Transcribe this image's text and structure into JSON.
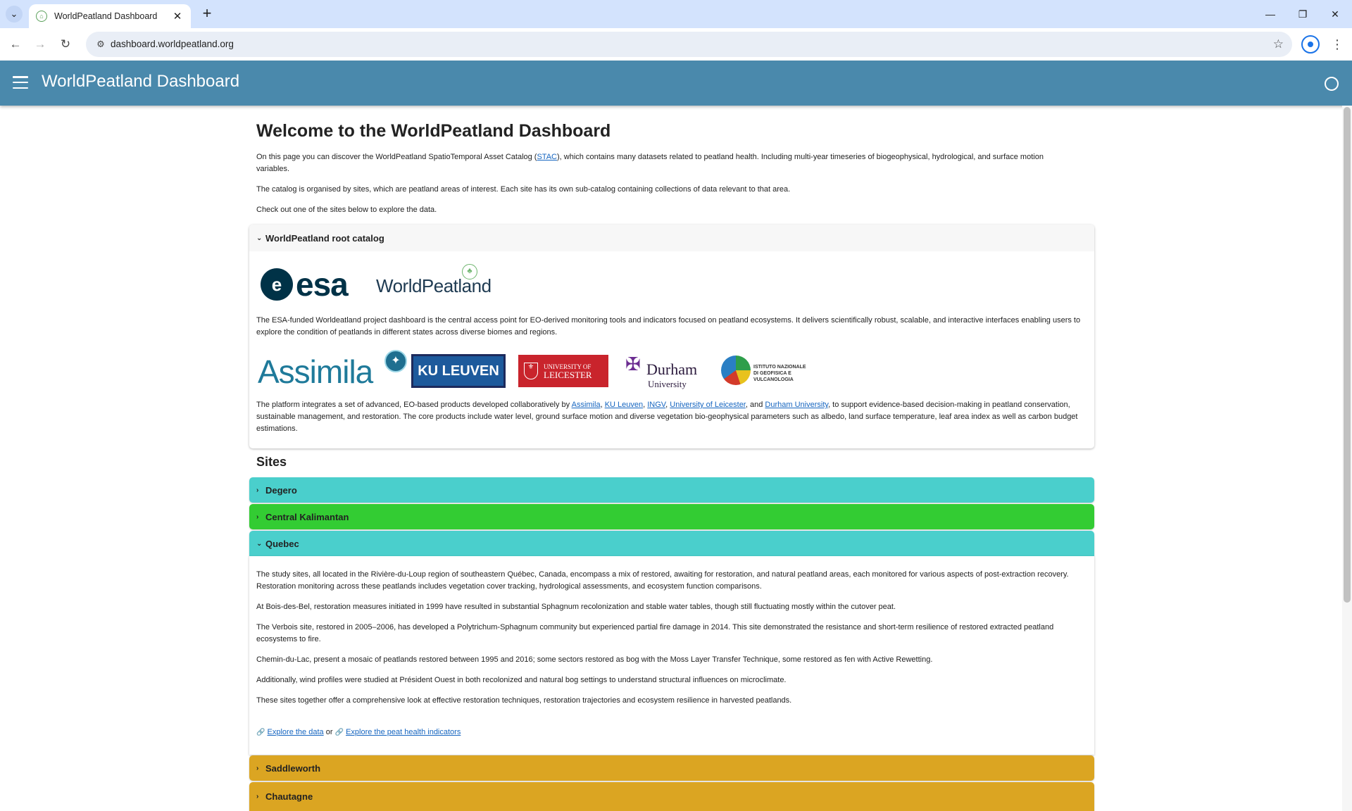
{
  "browser": {
    "tab_title": "WorldPeatland Dashboard",
    "url": "dashboard.worldpeatland.org"
  },
  "app": {
    "title": "WorldPeatland Dashboard"
  },
  "welcome": {
    "heading": "Welcome to the WorldPeatland Dashboard",
    "p1_before": "On this page you can discover the WorldPeatland SpatioTemporal Asset Catalog (",
    "p1_link": "STAC",
    "p1_after": "), which contains many datasets related to peatland health. Including multi-year timeseries of biogeophysical, hydrological, and surface motion variables.",
    "p2": "The catalog is organised by sites, which are peatland areas of interest. Each site has its own sub-catalog containing collections of data relevant to that area.",
    "p3": "Check out one of the sites below to explore the data."
  },
  "root_catalog": {
    "title": "WorldPeatland root catalog",
    "logo_esa": "esa",
    "logo_worldpeatland": "WorldPeatland",
    "description": "The ESA-funded Worldeatland project dashboard is the central access point for EO-derived monitoring tools and indicators focused on peatland ecosystems. It delivers scientifically robust, scalable, and interactive interfaces enabling users to explore the condition of peatlands in different states across diverse biomes and regions.",
    "partners": {
      "assimila": "Assimila",
      "ku_leuven": "KU LEUVEN",
      "leicester_1": "UNIVERSITY OF",
      "leicester_2": "LEICESTER",
      "durham_1": "Durham",
      "durham_2": "University",
      "ingv_1": "ISTITUTO NAZIONALE",
      "ingv_2": "DI GEOFISICA E VULCANOLOGIA"
    },
    "platform_before": "The platform integrates a set of advanced, EO-based products developed collaboratively by ",
    "link_assimila": "Assimila",
    "link_kuleuven": "KU Leuven",
    "link_ingv": "INGV",
    "link_leicester": "University of Leicester",
    "sep_comma": ", ",
    "sep_and": ", and ",
    "link_durham": "Durham University",
    "platform_after": ", to support evidence-based decision-making in peatland conservation, sustainable management, and restoration. The core products include water level, ground surface motion and diverse vegetation bio-geophysical parameters such as albedo, land surface temperature, leaf area index as well as carbon budget estimations."
  },
  "sites": {
    "heading": "Sites",
    "degero": "Degero",
    "central_kalimantan": "Central Kalimantan",
    "quebec": "Quebec",
    "saddleworth": "Saddleworth",
    "chautagne": "Chautagne",
    "quebec_details": {
      "p1": "The study sites, all located in the Rivière-du-Loup region of southeastern Québec, Canada, encompass a mix of restored, awaiting for restoration, and natural peatland areas, each monitored for various aspects of post-extraction recovery. Restoration monitoring across these peatlands includes vegetation cover tracking, hydrological assessments, and ecosystem function comparisons.",
      "p2": "At Bois-des-Bel, restoration measures initiated in 1999 have resulted in substantial Sphagnum recolonization and stable water tables, though still fluctuating mostly within the cutover peat.",
      "p3": "The Verbois site, restored in 2005–2006, has developed a Polytrichum-Sphagnum community but experienced partial fire damage in 2014. This site demonstrated the resistance and short-term resilience of restored extracted peatland ecosystems to fire.",
      "p4": "Chemin-du-Lac, present a mosaic of peatlands restored between 1995 and 2016; some sectors restored as bog with the Moss Layer Transfer Technique, some restored as fen with Active Rewetting.",
      "p5": "Additionally, wind profiles were studied at Président Ouest in both recolonized and natural bog settings to understand structural influences on microclimate.",
      "p6": "These sites together offer a comprehensive look at effective restoration techniques, restoration trajectories and ecosystem resilience in harvested peatlands.",
      "explore_data": "Explore the data",
      "or": "or",
      "explore_indicators": "Explore the peat health indicators"
    }
  },
  "colors": {
    "header": "#4a89ac",
    "site_teal": "#4acfcc",
    "site_green": "#33cc33",
    "site_gold": "#dba522",
    "link": "#1565c0"
  }
}
